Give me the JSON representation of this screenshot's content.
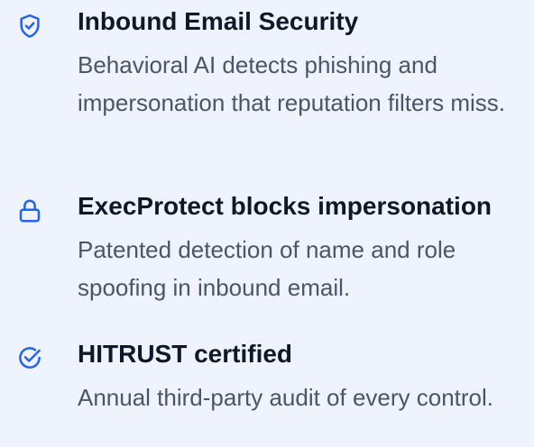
{
  "colors": {
    "background": "#eef3fd",
    "icon": "#2563eb",
    "title": "#101828",
    "description": "#4b5565"
  },
  "features": [
    {
      "icon": "shield-check-icon",
      "title": "Inbound Email Security",
      "description": "Behavioral AI detects phishing and impersonation that reputation filters miss."
    },
    {
      "icon": "lock-icon",
      "title": "ExecProtect blocks impersonation",
      "description": "Patented detection of name and role spoofing in inbound email."
    },
    {
      "icon": "badge-check-icon",
      "title": "HITRUST certified",
      "description": "Annual third-party audit of every control."
    }
  ]
}
